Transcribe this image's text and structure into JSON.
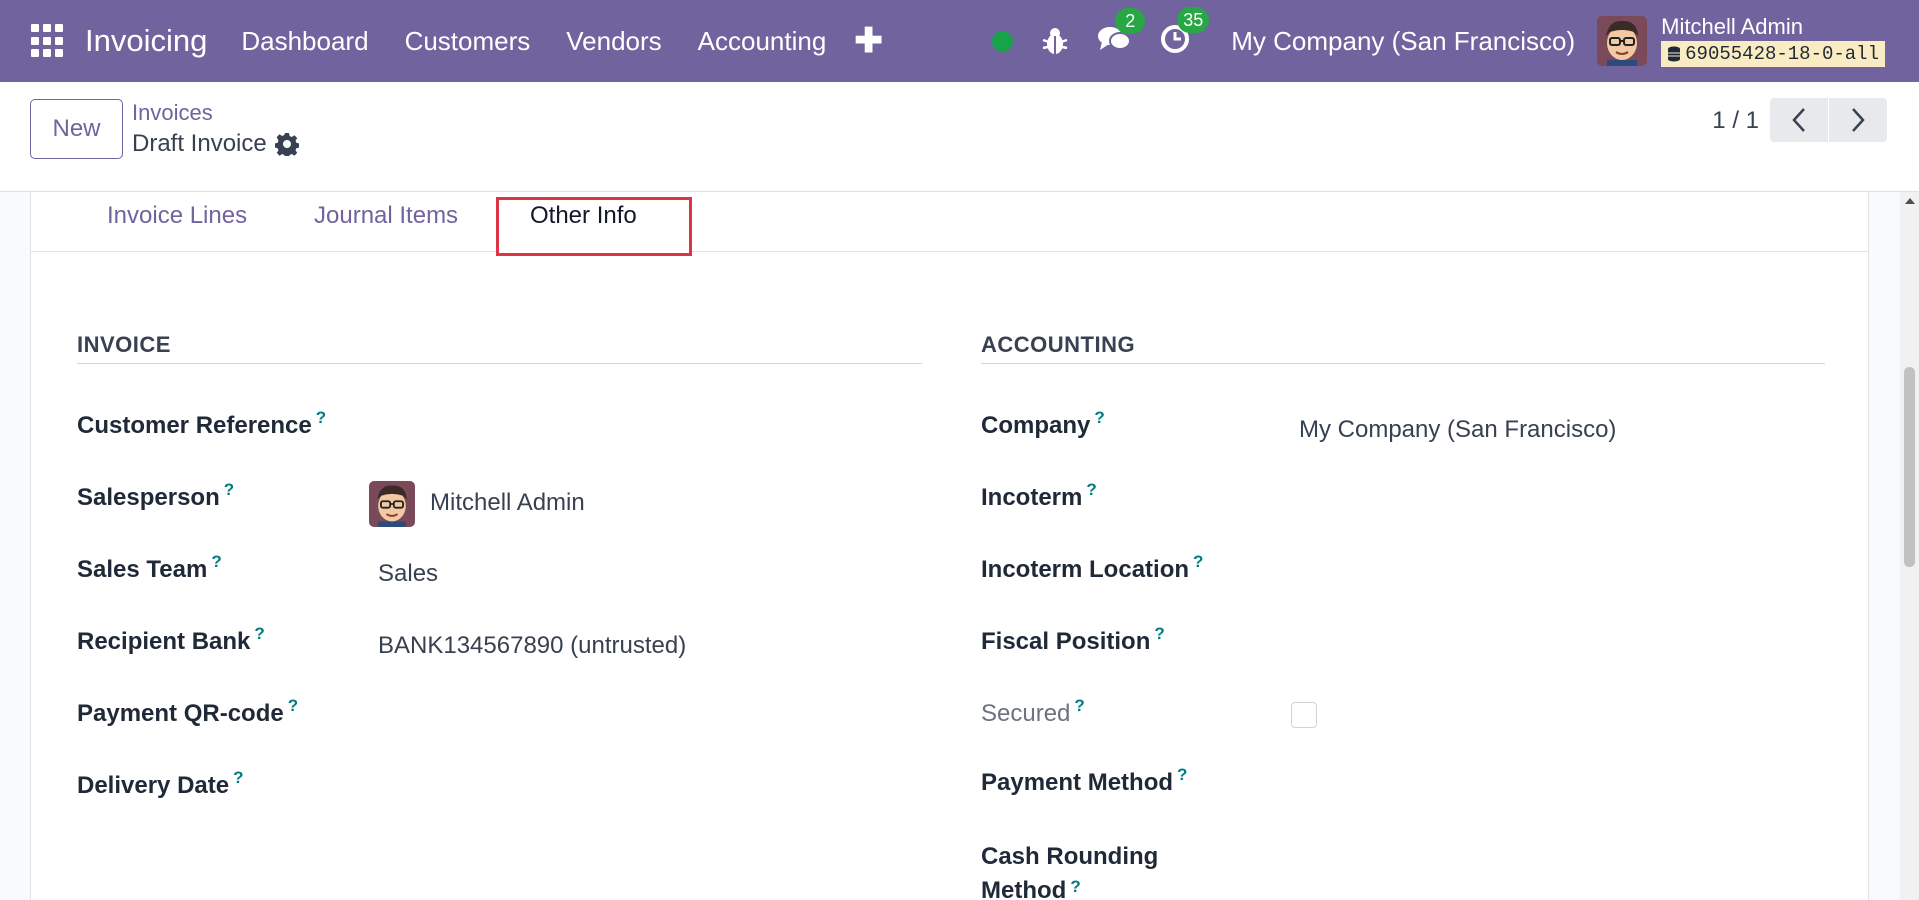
{
  "navbar": {
    "app_name": "Invoicing",
    "menu": [
      "Dashboard",
      "Customers",
      "Vendors",
      "Accounting"
    ],
    "plus": "✚",
    "messages_count": "2",
    "activities_count": "35",
    "company": "My Company (San Francisco)",
    "user_name": "Mitchell Admin",
    "db_name": "69055428-18-0-all",
    "bg_color": "#71639e"
  },
  "control_panel": {
    "new_label": "New",
    "breadcrumb": "Invoices",
    "record_title": "Draft Invoice",
    "pager": "1 / 1"
  },
  "tabs": {
    "invoice_lines": "Invoice Lines",
    "journal_items": "Journal Items",
    "other_info": "Other Info",
    "active": "Other Info"
  },
  "invoice_section": {
    "title": "INVOICE",
    "fields": {
      "customer_reference": {
        "label": "Customer Reference",
        "value": ""
      },
      "salesperson": {
        "label": "Salesperson",
        "value": "Mitchell Admin"
      },
      "sales_team": {
        "label": "Sales Team",
        "value": "Sales"
      },
      "recipient_bank": {
        "label": "Recipient Bank",
        "value": "BANK134567890 (untrusted)"
      },
      "payment_qr": {
        "label": "Payment QR-code",
        "value": ""
      },
      "delivery_date": {
        "label": "Delivery Date",
        "value": ""
      }
    }
  },
  "accounting_section": {
    "title": "ACCOUNTING",
    "fields": {
      "company": {
        "label": "Company",
        "value": "My Company (San Francisco)"
      },
      "incoterm": {
        "label": "Incoterm",
        "value": ""
      },
      "incoterm_location": {
        "label": "Incoterm Location",
        "value": ""
      },
      "fiscal_position": {
        "label": "Fiscal Position",
        "value": ""
      },
      "secured": {
        "label": "Secured",
        "checked": false
      },
      "payment_method": {
        "label": "Payment Method",
        "value": ""
      },
      "cash_rounding_line1": "Cash Rounding",
      "cash_rounding_line2": "Method"
    }
  },
  "help_mark": "?"
}
